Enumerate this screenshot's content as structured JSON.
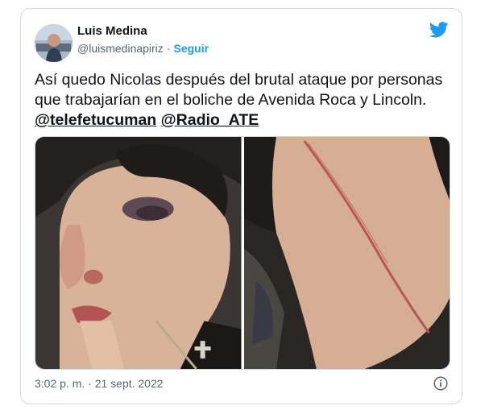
{
  "author": {
    "name": "Luis Medina",
    "handle": "@luismedinapiriz",
    "separator": "·",
    "follow_label": "Seguir"
  },
  "tweet": {
    "text": "Así quedo Nicolas después del brutal ataque por personas que trabajarían en el boliche de Avenida Roca y Lincoln.",
    "mentions": [
      "@telefetucuman",
      "@Radio_ATE"
    ]
  },
  "media": {
    "photos": [
      "face-photo",
      "back-photo"
    ]
  },
  "footer": {
    "timestamp": "3:02 p. m. · 21 sept. 2022"
  },
  "colors": {
    "brand": "#1d9bf0",
    "text": "#0f1419",
    "secondary": "#536471",
    "border": "#cfd9de"
  },
  "icons": {
    "platform": "twitter-bird-icon",
    "info": "info-icon"
  }
}
